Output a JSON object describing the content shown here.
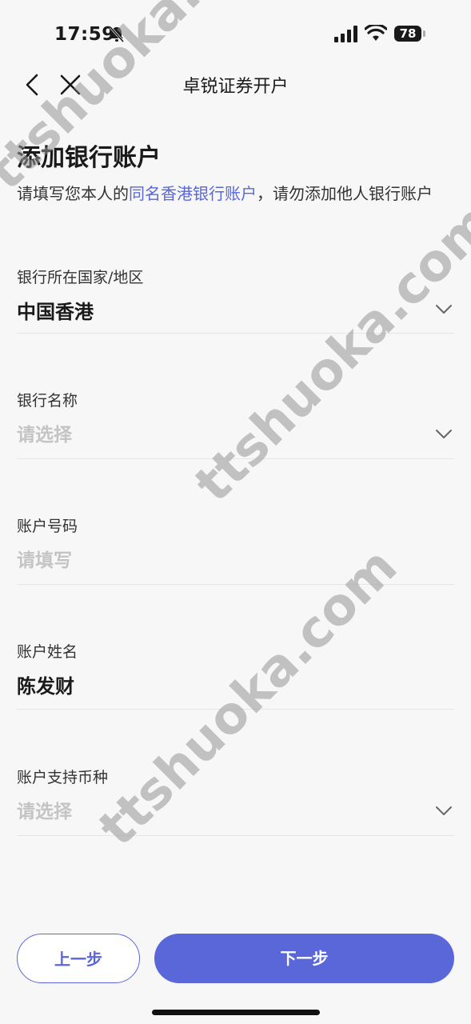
{
  "status_bar": {
    "time": "17:59",
    "battery": "78"
  },
  "nav": {
    "title": "卓锐证券开户"
  },
  "page": {
    "title": "添加银行账户",
    "description_prefix": "请填写您本人的",
    "description_link": "同名香港银行账户",
    "description_suffix": "，请勿添加他人银行账户"
  },
  "form": {
    "bank_country": {
      "label": "银行所在国家/地区",
      "value": "中国香港"
    },
    "bank_name": {
      "label": "银行名称",
      "placeholder": "请选择"
    },
    "account_number": {
      "label": "账户号码",
      "placeholder": "请填写"
    },
    "account_name": {
      "label": "账户姓名",
      "value": "陈发财"
    },
    "currency": {
      "label": "账户支持币种",
      "placeholder": "请选择"
    }
  },
  "buttons": {
    "prev": "上一步",
    "next": "下一步"
  },
  "watermark": {
    "text": "ttshuoka.com"
  },
  "colors": {
    "accent": "#5a67d8",
    "background": "#f7f7f7"
  }
}
